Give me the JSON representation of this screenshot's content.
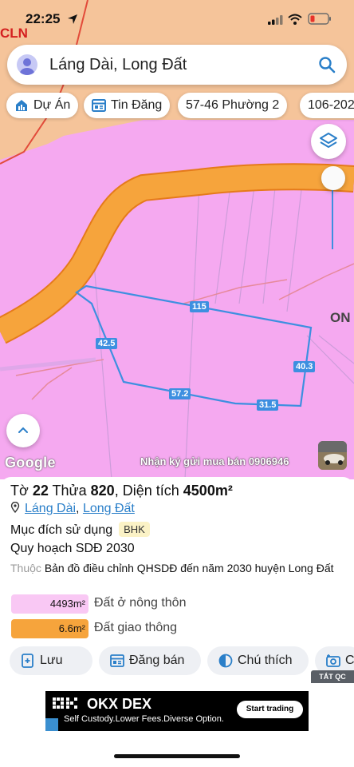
{
  "status_bar": {
    "time": "22:25",
    "map_corner_text": "CLN"
  },
  "search": {
    "query": "Láng Dài, Long Đất"
  },
  "chips": [
    {
      "label": "Dự Án",
      "icon": "home-chart-icon"
    },
    {
      "label": "Tin Đăng",
      "icon": "listing-icon"
    },
    {
      "label": "57-46 Phường 2"
    },
    {
      "label": "106-202"
    }
  ],
  "map": {
    "edge_text": "ON",
    "dimensions": [
      "115",
      "42.5",
      "40.3",
      "57.2",
      "31.5"
    ],
    "google_label": "Google",
    "banner_text": "Nhận ký gửi mua bán 0906946"
  },
  "parcel": {
    "sheet_label": "Tờ",
    "sheet": "22",
    "plot_label": "Thửa",
    "plot": "820",
    "area_label": "Diện tích",
    "area": "4500m²",
    "commune": "Láng Dài",
    "district": "Long Đất",
    "purpose_label": "Mục đích sử dụng",
    "purpose_code": "BHK",
    "plan_title": "Quy hoạch SDĐ 2030",
    "belongs_label": "Thuộc",
    "belongs_text": "Bản đồ điều chỉnh QHSDĐ đến năm 2030 huyện Long Đất"
  },
  "legend": [
    {
      "value": "4493m²",
      "label": "Đất ở nông thôn",
      "color": "#f9c8f4"
    },
    {
      "value": "6.6m²",
      "label": "Đất giao thông",
      "color": "#f6a43c"
    }
  ],
  "actions": [
    {
      "label": "Lưu",
      "icon": "add-note-icon"
    },
    {
      "label": "Đăng bán",
      "icon": "listing-icon"
    },
    {
      "label": "Chú thích",
      "icon": "half-circle-icon"
    },
    {
      "label": "C",
      "icon": "camera-icon"
    }
  ],
  "ad": {
    "tag": "TẮT QC",
    "brand": "OKX DEX",
    "tagline": "Self Custody.Lower Fees.Diverse Option.",
    "cta": "Start trading"
  },
  "colors": {
    "map_pink": "#f5a9f0",
    "road_orange": "#f6a43c",
    "parcel_blue": "#3d8fe0",
    "link_blue": "#2a7fc9"
  }
}
